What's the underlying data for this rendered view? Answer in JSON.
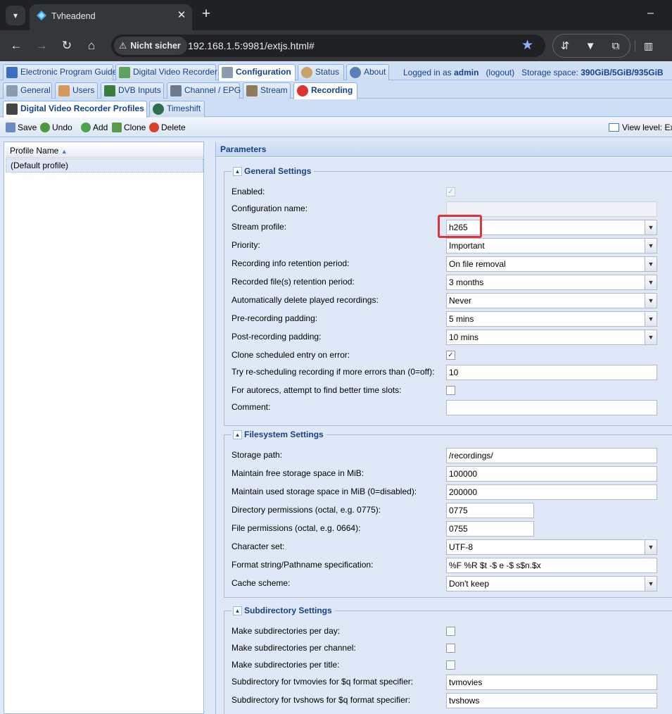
{
  "browser": {
    "tab_title": "Tvheadend",
    "security_label": "Nicht sicher",
    "url": "192.168.1.5:9981/extjs.html#"
  },
  "main_tabs": [
    {
      "label": "Electronic Program Guide",
      "icon": "epg-icon"
    },
    {
      "label": "Digital Video Recorder",
      "icon": "download-icon"
    },
    {
      "label": "Configuration",
      "icon": "wrench-icon"
    },
    {
      "label": "Status",
      "icon": "eye-icon"
    },
    {
      "label": "About",
      "icon": "info-icon"
    }
  ],
  "status": {
    "logged_in_prefix": "Logged in as",
    "user": "admin",
    "logout": "(logout)",
    "storage_label": "Storage space:",
    "storage_value": "390GiB/5GiB/935GiB"
  },
  "config_tabs": [
    {
      "label": "General"
    },
    {
      "label": "Users"
    },
    {
      "label": "DVB Inputs"
    },
    {
      "label": "Channel / EPG"
    },
    {
      "label": "Stream"
    },
    {
      "label": "Recording"
    }
  ],
  "recording_tabs": [
    {
      "label": "Digital Video Recorder Profiles"
    },
    {
      "label": "Timeshift"
    }
  ],
  "actions": {
    "save": "Save",
    "undo": "Undo",
    "add": "Add",
    "clone": "Clone",
    "delete": "Delete",
    "view_level": "View level: Exp"
  },
  "grid": {
    "column": "Profile Name",
    "rows": [
      "(Default profile)"
    ]
  },
  "panel_title": "Parameters",
  "general": {
    "legend": "General Settings",
    "enabled_label": "Enabled:",
    "config_name_label": "Configuration name:",
    "config_name_value": "",
    "stream_profile_label": "Stream profile:",
    "stream_profile_value": "h265",
    "priority_label": "Priority:",
    "priority_value": "Important",
    "info_retention_label": "Recording info retention period:",
    "info_retention_value": "On file removal",
    "file_retention_label": "Recorded file(s) retention period:",
    "file_retention_value": "3 months",
    "auto_delete_label": "Automatically delete played recordings:",
    "auto_delete_value": "Never",
    "pre_padding_label": "Pre-recording padding:",
    "pre_padding_value": "5 mins",
    "post_padding_label": "Post-recording padding:",
    "post_padding_value": "10 mins",
    "clone_error_label": "Clone scheduled entry on error:",
    "retry_label": "Try re-scheduling recording if more errors than (0=off):",
    "retry_value": "10",
    "autorec_label": "For autorecs, attempt to find better time slots:",
    "comment_label": "Comment:",
    "comment_value": ""
  },
  "filesystem": {
    "legend": "Filesystem Settings",
    "storage_path_label": "Storage path:",
    "storage_path_value": "/recordings/",
    "free_space_label": "Maintain free storage space in MiB:",
    "free_space_value": "100000",
    "used_space_label": "Maintain used storage space in MiB (0=disabled):",
    "used_space_value": "200000",
    "dir_perm_label": "Directory permissions (octal, e.g. 0775):",
    "dir_perm_value": "0775",
    "file_perm_label": "File permissions (octal, e.g. 0664):",
    "file_perm_value": "0755",
    "charset_label": "Character set:",
    "charset_value": "UTF-8",
    "format_label": "Format string/Pathname specification:",
    "format_value": "%F %R $t -$ e -$ s$n.$x",
    "cache_label": "Cache scheme:",
    "cache_value": "Don't keep"
  },
  "subdirectory": {
    "legend": "Subdirectory Settings",
    "per_day_label": "Make subdirectories per day:",
    "per_channel_label": "Make subdirectories per channel:",
    "per_title_label": "Make subdirectories per title:",
    "tvmovies_label": "Subdirectory for tvmovies for $q format specifier:",
    "tvmovies_value": "tvmovies",
    "tvshows_label": "Subdirectory for tvshows for $q format specifier:",
    "tvshows_value": "tvshows"
  },
  "colors": {
    "accent": "#15428b",
    "highlight": "#e0343a"
  }
}
